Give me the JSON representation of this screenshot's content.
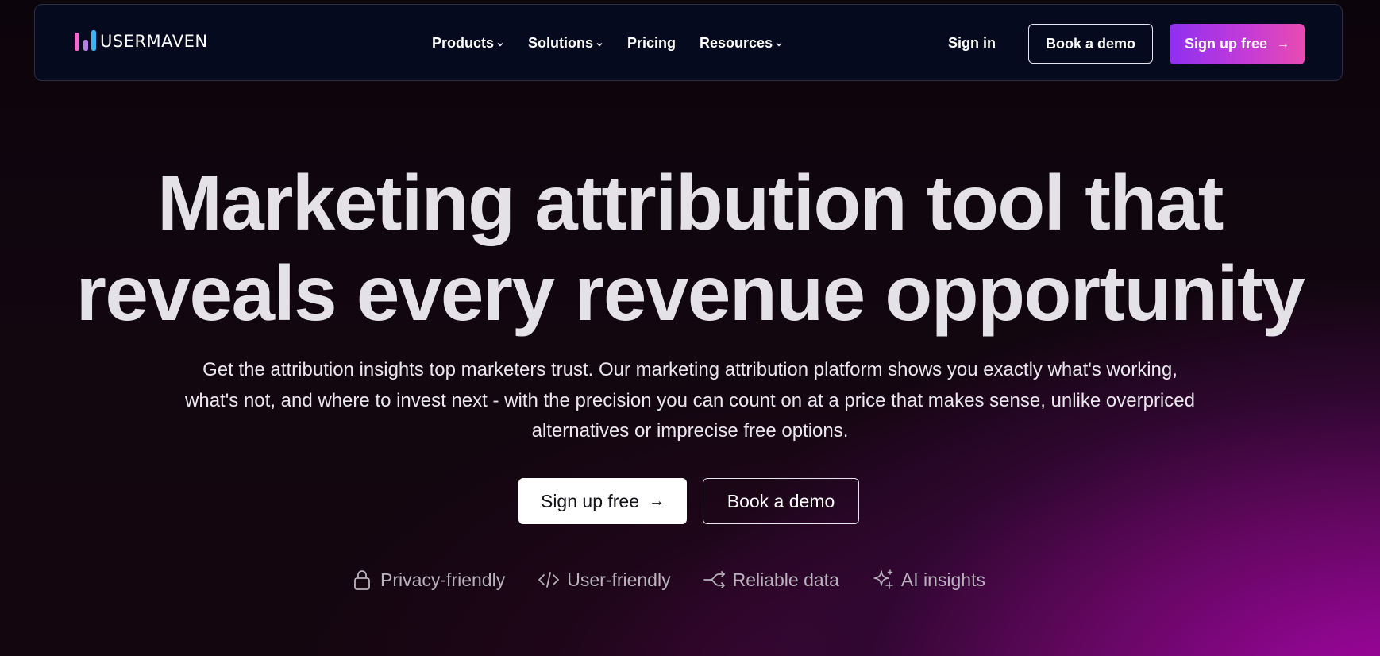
{
  "brand": {
    "name": "USERMAVEN",
    "colors": {
      "pink": "#f06bd0",
      "blue": "#38b6f5",
      "accent_start": "#8f30f0",
      "accent_end": "#e84bb2"
    }
  },
  "nav": {
    "menu": [
      {
        "label": "Products",
        "has_dropdown": true
      },
      {
        "label": "Solutions",
        "has_dropdown": true
      },
      {
        "label": "Pricing",
        "has_dropdown": false
      },
      {
        "label": "Resources",
        "has_dropdown": true
      }
    ],
    "sign_in": "Sign in",
    "book_demo": "Book a demo",
    "sign_up": "Sign up free"
  },
  "hero": {
    "headline_line1": "Marketing attribution tool that",
    "headline_line2": "reveals every revenue opportunity",
    "subheadline": "Get the attribution insights top marketers trust. Our marketing attribution platform shows you exactly what's working, what's not, and where to invest next - with the precision you can count on at a price that makes sense, unlike overpriced alternatives or imprecise free options.",
    "cta_primary": "Sign up free",
    "cta_secondary": "Book a demo",
    "features": [
      {
        "label": "Privacy-friendly",
        "icon": "lock-icon"
      },
      {
        "label": "User-friendly",
        "icon": "code-icon"
      },
      {
        "label": "Reliable data",
        "icon": "share-icon"
      },
      {
        "label": "AI insights",
        "icon": "sparkle-icon"
      }
    ]
  }
}
